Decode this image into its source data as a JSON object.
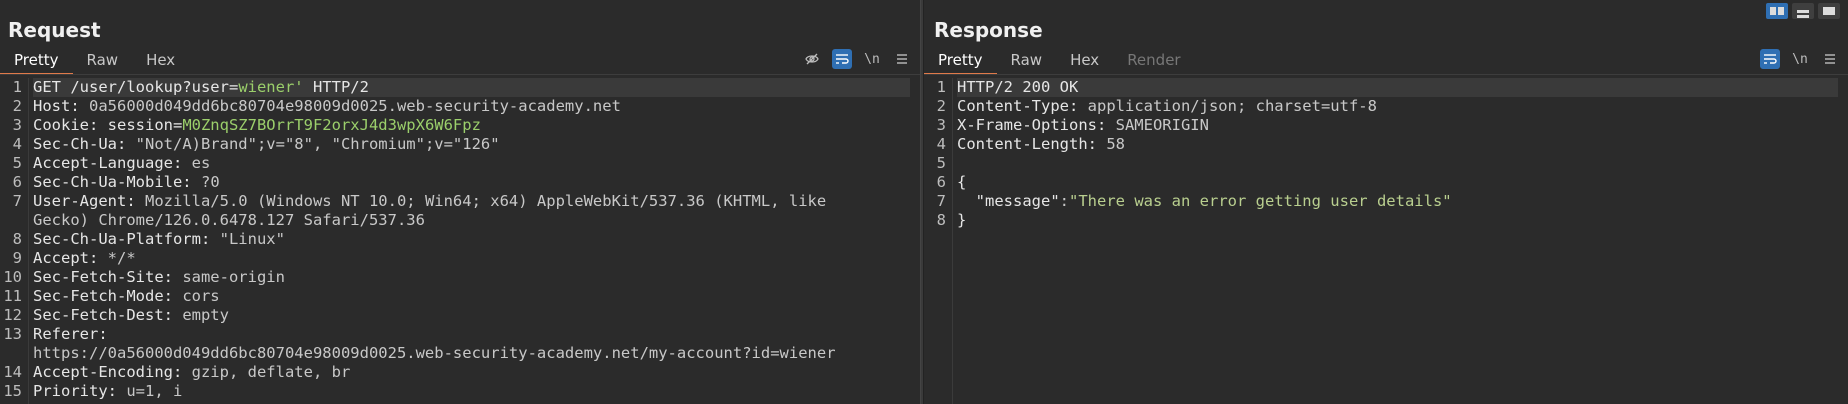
{
  "request": {
    "title": "Request",
    "tabs": [
      "Pretty",
      "Raw",
      "Hex"
    ],
    "active_tab": "Pretty",
    "lines": [
      {
        "n": "1",
        "parts": [
          [
            "k",
            "GET /user/lookup?user="
          ],
          [
            "g",
            "wiener'"
          ],
          [
            "k",
            " HTTP/2"
          ]
        ]
      },
      {
        "n": "2",
        "parts": [
          [
            "k",
            "Host: "
          ],
          [
            "v",
            "0a56000d049dd6bc80704e98009d0025.web-security-academy.net"
          ]
        ]
      },
      {
        "n": "3",
        "parts": [
          [
            "k",
            "Cookie: session="
          ],
          [
            "g",
            "M0ZnqSZ7BOrrT9F2orxJ4d3wpX6W6Fpz"
          ]
        ]
      },
      {
        "n": "4",
        "parts": [
          [
            "k",
            "Sec-Ch-Ua: "
          ],
          [
            "v",
            "\"Not/A)Brand\";v=\"8\", \"Chromium\";v=\"126\""
          ]
        ]
      },
      {
        "n": "5",
        "parts": [
          [
            "k",
            "Accept-Language: "
          ],
          [
            "v",
            "es"
          ]
        ]
      },
      {
        "n": "6",
        "parts": [
          [
            "k",
            "Sec-Ch-Ua-Mobile: "
          ],
          [
            "v",
            "?0"
          ]
        ]
      },
      {
        "n": "7",
        "parts": [
          [
            "k",
            "User-Agent: "
          ],
          [
            "v",
            "Mozilla/5.0 (Windows NT 10.0; Win64; x64) AppleWebKit/537.36 (KHTML, like"
          ]
        ]
      },
      {
        "n": "",
        "parts": [
          [
            "v",
            "Gecko) Chrome/126.0.6478.127 Safari/537.36"
          ]
        ]
      },
      {
        "n": "8",
        "parts": [
          [
            "k",
            "Sec-Ch-Ua-Platform: "
          ],
          [
            "v",
            "\"Linux\""
          ]
        ]
      },
      {
        "n": "9",
        "parts": [
          [
            "k",
            "Accept: "
          ],
          [
            "v",
            "*/*"
          ]
        ]
      },
      {
        "n": "10",
        "parts": [
          [
            "k",
            "Sec-Fetch-Site: "
          ],
          [
            "v",
            "same-origin"
          ]
        ]
      },
      {
        "n": "11",
        "parts": [
          [
            "k",
            "Sec-Fetch-Mode: "
          ],
          [
            "v",
            "cors"
          ]
        ]
      },
      {
        "n": "12",
        "parts": [
          [
            "k",
            "Sec-Fetch-Dest: "
          ],
          [
            "v",
            "empty"
          ]
        ]
      },
      {
        "n": "13",
        "parts": [
          [
            "k",
            "Referer:"
          ]
        ]
      },
      {
        "n": "",
        "parts": [
          [
            "v",
            "https://0a56000d049dd6bc80704e98009d0025.web-security-academy.net/my-account?id=wiener"
          ]
        ]
      },
      {
        "n": "14",
        "parts": [
          [
            "k",
            "Accept-Encoding: "
          ],
          [
            "v",
            "gzip, deflate, br"
          ]
        ]
      },
      {
        "n": "15",
        "parts": [
          [
            "k",
            "Priority: "
          ],
          [
            "v",
            "u=1, i"
          ]
        ]
      }
    ]
  },
  "response": {
    "title": "Response",
    "tabs": [
      "Pretty",
      "Raw",
      "Hex",
      "Render"
    ],
    "active_tab": "Pretty",
    "lines": [
      {
        "n": "1",
        "parts": [
          [
            "k",
            "HTTP/2 200 OK"
          ]
        ]
      },
      {
        "n": "2",
        "parts": [
          [
            "k",
            "Content-Type: "
          ],
          [
            "v",
            "application/json; charset=utf-8"
          ]
        ]
      },
      {
        "n": "3",
        "parts": [
          [
            "k",
            "X-Frame-Options: "
          ],
          [
            "v",
            "SAMEORIGIN"
          ]
        ]
      },
      {
        "n": "4",
        "parts": [
          [
            "k",
            "Content-Length: "
          ],
          [
            "v",
            "58"
          ]
        ]
      },
      {
        "n": "5",
        "parts": [
          [
            "k",
            ""
          ]
        ]
      },
      {
        "n": "6",
        "parts": [
          [
            "k",
            "{"
          ]
        ]
      },
      {
        "n": "7",
        "parts": [
          [
            "k",
            "  "
          ],
          [
            "k",
            "\"message\""
          ],
          [
            "v",
            ":"
          ],
          [
            "s",
            "\"There was an error getting user details\""
          ]
        ]
      },
      {
        "n": "8",
        "parts": [
          [
            "k",
            "}"
          ]
        ]
      }
    ]
  },
  "toolbar": {
    "hide_icon": "eye-off-icon",
    "wrap_icon": "wrap-lines-icon",
    "newline_label": "\\n",
    "menu_icon": "menu-icon"
  },
  "colors": {
    "accent": "#e07a4a",
    "toggle_on": "#2f6fb3",
    "string_green": "#9bcf6b"
  }
}
